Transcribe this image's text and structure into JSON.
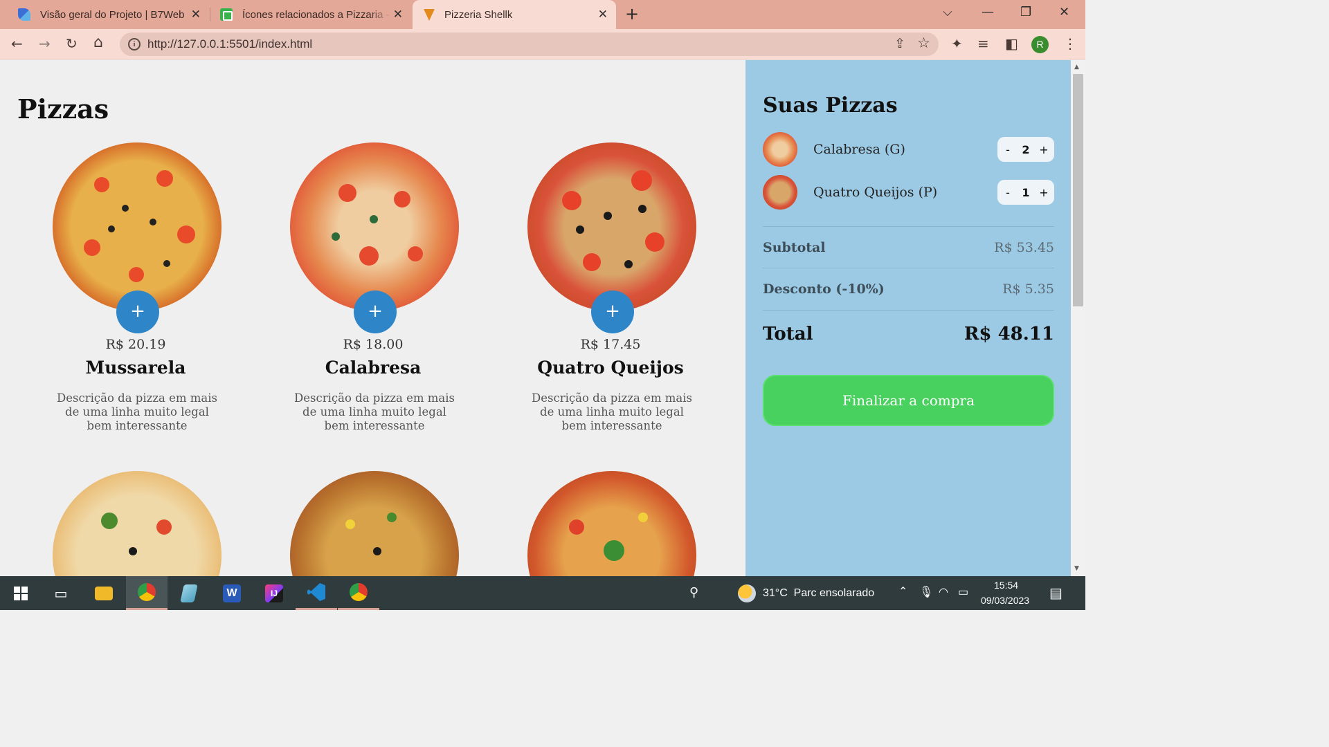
{
  "browser": {
    "tabs": [
      {
        "title": "Visão geral do Projeto | B7Web",
        "active": false
      },
      {
        "title": "Ícones relacionados a Pizzaria - B",
        "active": false
      },
      {
        "title": "Pizzeria Shellk",
        "active": true
      }
    ],
    "url": "http://127.0.0.1:5501/index.html",
    "profile_initial": "R"
  },
  "page": {
    "title": "Pizzas",
    "add_label": "+",
    "pizzas": [
      {
        "name": "Mussarela",
        "price": "R$ 20.19",
        "description": "Descrição da pizza em mais de uma linha muito legal bem interessante"
      },
      {
        "name": "Calabresa",
        "price": "R$ 18.00",
        "description": "Descrição da pizza em mais de uma linha muito legal bem interessante"
      },
      {
        "name": "Quatro Queijos",
        "price": "R$ 17.45",
        "description": "Descrição da pizza em mais de uma linha muito legal bem interessante"
      }
    ]
  },
  "cart": {
    "title": "Suas Pizzas",
    "items": [
      {
        "name": "Calabresa (G)",
        "qty": "2",
        "minus": "-",
        "plus": "+"
      },
      {
        "name": "Quatro Queijos (P)",
        "qty": "1",
        "minus": "-",
        "plus": "+"
      }
    ],
    "subtotal_label": "Subtotal",
    "subtotal_value": "R$ 53.45",
    "discount_label": "Desconto (-10%)",
    "discount_value": "R$ 5.35",
    "total_label": "Total",
    "total_value": "R$ 48.11",
    "checkout_label": "Finalizar a compra"
  },
  "colors": {
    "tabbar": "#e3a898",
    "active_tab": "#f8dcd4",
    "cart_bg": "#9ccae4",
    "add_button": "#2e86c8",
    "checkout_button": "#48d15e"
  },
  "taskbar": {
    "weather": "31°C  Parc ensolarado",
    "time": "15:54",
    "date": "09/03/2023"
  }
}
